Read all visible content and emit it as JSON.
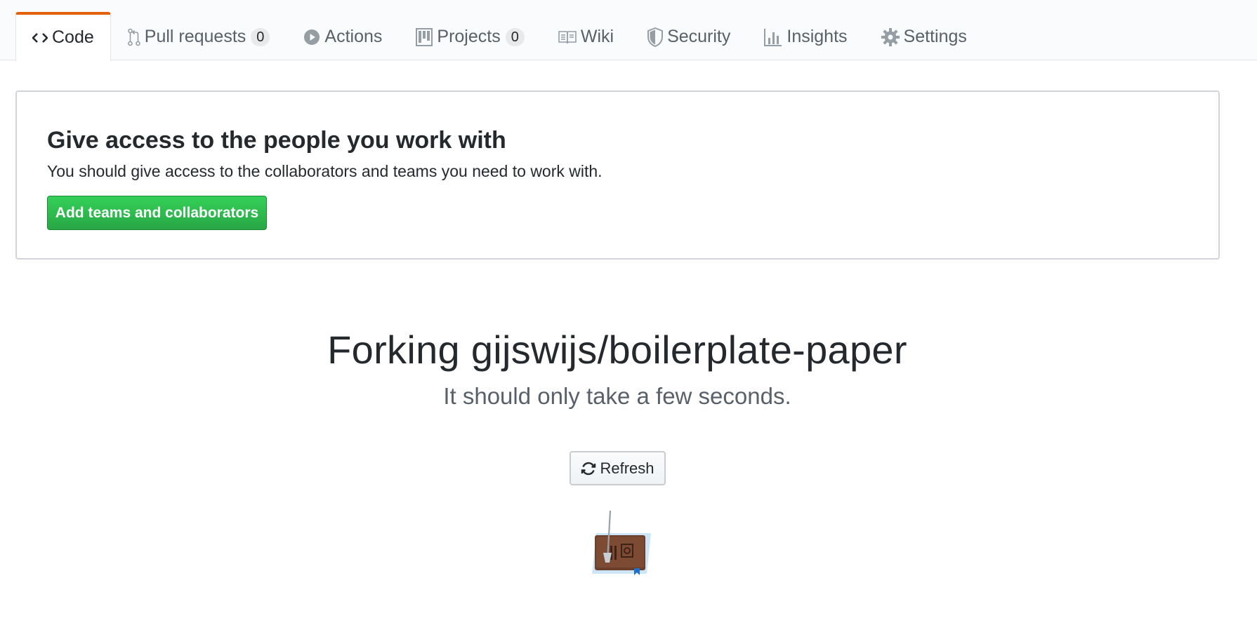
{
  "nav": {
    "tabs": [
      {
        "label": "Code",
        "icon": "code-icon",
        "selected": true
      },
      {
        "label": "Pull requests",
        "icon": "git-pull-request-icon",
        "counter": "0"
      },
      {
        "label": "Actions",
        "icon": "play-icon"
      },
      {
        "label": "Projects",
        "icon": "project-icon",
        "counter": "0"
      },
      {
        "label": "Wiki",
        "icon": "book-icon"
      },
      {
        "label": "Security",
        "icon": "shield-icon"
      },
      {
        "label": "Insights",
        "icon": "graph-icon"
      },
      {
        "label": "Settings",
        "icon": "gear-icon"
      }
    ],
    "selected_color": "#e36209"
  },
  "access": {
    "title": "Give access to the people you work with",
    "description": "You should give access to the collaborators and teams you need to work with.",
    "button_label": "Add teams and collaborators",
    "button_color": "#28a745"
  },
  "fork": {
    "title": "Forking gijswijs/boilerplate-paper",
    "subtitle": "It should only take a few seconds.",
    "refresh_label": "Refresh",
    "illustration": "forking-book-icon"
  }
}
